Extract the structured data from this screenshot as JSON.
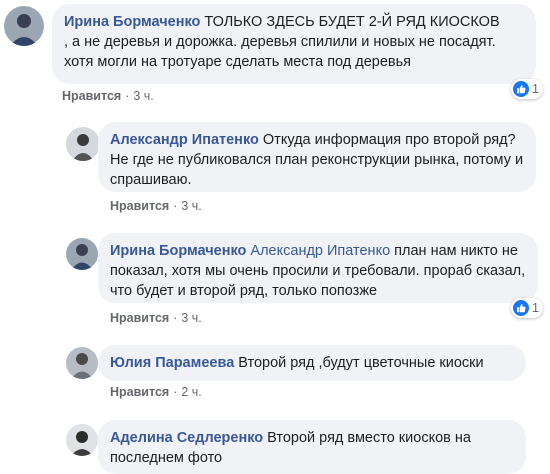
{
  "comments": [
    {
      "author": "Ирина Бормаченко",
      "mention": "",
      "text_line1": " ТОЛЬКО ЗДЕСЬ БУДЕТ 2-Й РЯД КИОСКОВ",
      "text_rest": ", а не деревья и дорожка. деревья спилили и новых не посадят. хотя могли на тротуаре сделать места под деревья",
      "like_label": "Нравится",
      "separator": "·",
      "time": "3 ч.",
      "reaction_count": "1",
      "reaction_icon": "like-icon"
    },
    {
      "author": "Александр Ипатенко",
      "mention": "",
      "text": " Откуда информация про второй ряд? Не где не публиковался план реконструкции рынка, потому и спрашиваю.",
      "like_label": "Нравится",
      "separator": "·",
      "time": "3 ч."
    },
    {
      "author": "Ирина Бормаченко",
      "mention": "Александр Ипатенко",
      "text": " план нам никто не показал, хотя мы очень просили и требовали. прораб сказал, что будет и второй ряд, только попозже",
      "like_label": "Нравится",
      "separator": "·",
      "time": "3 ч.",
      "reaction_count": "1",
      "reaction_icon": "like-icon"
    },
    {
      "author": "Юлия Парамеева",
      "mention": "",
      "text": " Второй ряд ,будут цветочные киоски",
      "like_label": "Нравится",
      "separator": "·",
      "time": "2 ч."
    },
    {
      "author": "Аделина Седлеренко",
      "mention": "",
      "text": " Второй ряд вместо киосков на последнем фото",
      "like_label": "",
      "separator": "",
      "time": ""
    }
  ],
  "colors": {
    "bubble": "#f0f2f5",
    "author": "#385898",
    "meta": "#65676b",
    "like_blue": "#1877f2"
  }
}
